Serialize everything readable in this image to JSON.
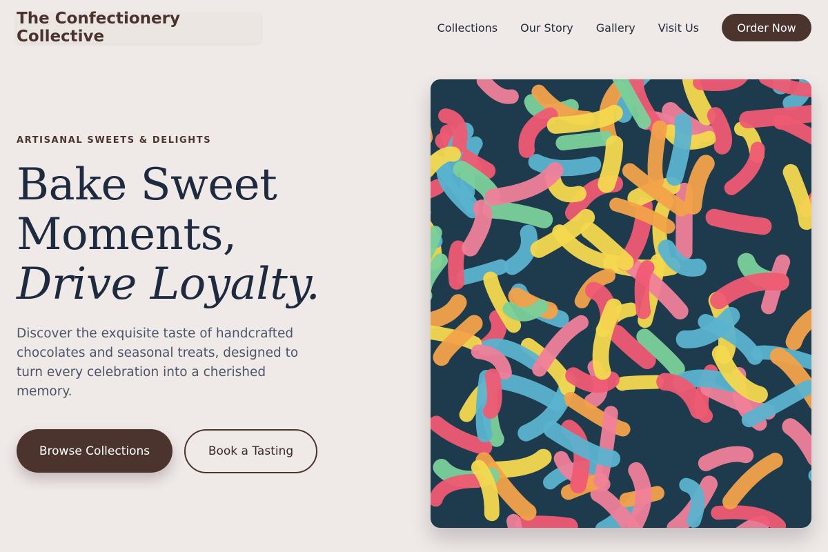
{
  "header": {
    "brand": "The Confectionery Collective",
    "nav": [
      "Collections",
      "Our Story",
      "Gallery",
      "Visit Us"
    ],
    "cta": "Order Now"
  },
  "hero": {
    "eyebrow": "ARTISANAL SWEETS & DELIGHTS",
    "headline_line1": "Bake Sweet",
    "headline_line2": "Moments,",
    "headline_line3": "Drive Loyalty.",
    "description": "Discover the exquisite taste of handcrafted chocolates and seasonal treats, designed to turn every celebration into a cherished memory.",
    "primary_button": "Browse Collections",
    "secondary_button": "Book a Tasting"
  },
  "image": {
    "subject": "gummy-worms-photo",
    "colors": [
      "#ef5b73",
      "#f3a24a",
      "#f4d84e",
      "#7bd09a",
      "#5bb3cf",
      "#f07f9a"
    ]
  }
}
